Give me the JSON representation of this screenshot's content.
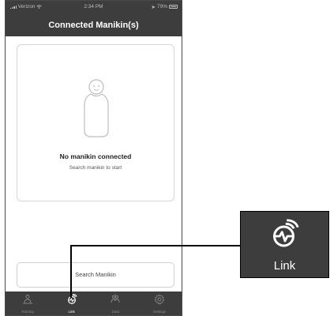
{
  "status_bar": {
    "carrier": "Verizon",
    "time": "2:34 PM",
    "battery": "79%"
  },
  "header": {
    "title": "Connected Manikin(s)"
  },
  "main": {
    "empty_title": "No manikin connected",
    "empty_subtitle": "Search manikin to start",
    "search_button_label": "Search Manikin"
  },
  "tabs": [
    {
      "label": "Training",
      "icon": "training-icon",
      "active": false
    },
    {
      "label": "Link",
      "icon": "link-icon",
      "active": true
    },
    {
      "label": "Data",
      "icon": "data-icon",
      "active": false
    },
    {
      "label": "Settings",
      "icon": "gear-icon",
      "active": false
    }
  ],
  "callout": {
    "label": "Link",
    "icon": "link-icon"
  },
  "colors": {
    "bar_background": "#3d3d3d",
    "active_tab": "#ffffff",
    "inactive_tab": "#8a8a8a"
  }
}
